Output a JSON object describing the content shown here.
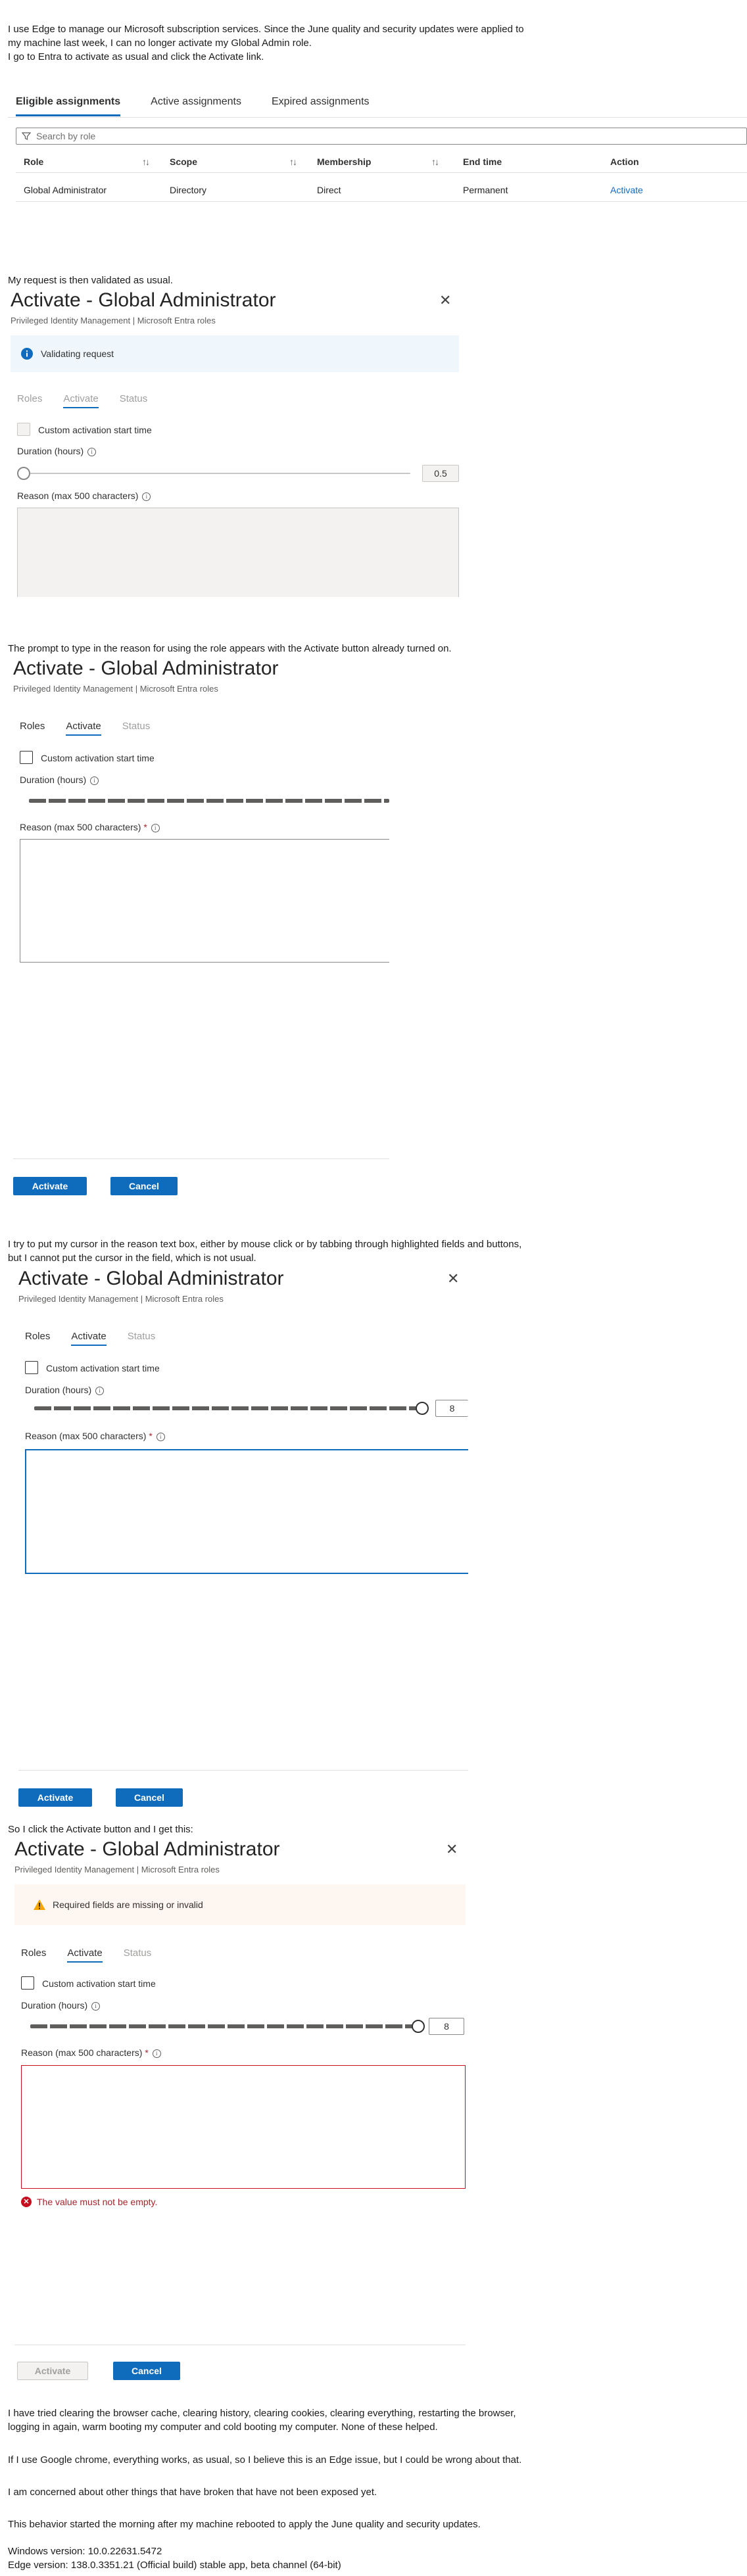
{
  "intro": {
    "text": "I use Edge to manage our Microsoft subscription services.  Since the June quality and security updates were applied to\nmy machine last week, I can no longer activate my Global Admin role.\nI go to Entra to activate as usual and click the Activate link."
  },
  "assignments": {
    "tabs": [
      "Eligible assignments",
      "Active assignments",
      "Expired assignments"
    ],
    "search_placeholder": "Search by role",
    "columns": [
      "Role",
      "Scope",
      "Membership",
      "End time",
      "Action"
    ],
    "row": {
      "role": "Global Administrator",
      "scope": "Directory",
      "membership": "Direct",
      "end_time": "Permanent",
      "action": "Activate"
    }
  },
  "para2": "My request is then validated as usual.",
  "para3": "The prompt to type in the reason for using the role appears with the Activate button already turned on.",
  "para4": "I try to put my cursor in the reason text box, either by mouse click or by tabbing through highlighted fields and buttons,\nbut I cannot put the cursor in the field, which is not usual.",
  "para5": "So I click the Activate button and I get this:",
  "panel": {
    "title": "Activate - Global Administrator",
    "subtitle": "Privileged Identity Management | Microsoft Entra roles",
    "tabs": [
      "Roles",
      "Activate",
      "Status"
    ],
    "custom_start": "Custom activation start time",
    "duration_label": "Duration (hours)",
    "reason_label": "Reason (max 500 characters)",
    "required_mark": "*",
    "activate": "Activate",
    "cancel": "Cancel"
  },
  "panel1": {
    "banner": "Validating request",
    "duration_value": "0.5"
  },
  "panel3": {
    "duration_value": "8"
  },
  "panel4": {
    "banner": "Required fields are missing or invalid",
    "duration_value": "8",
    "error": "The value must not be empty."
  },
  "outro": {
    "p1": "I have tried clearing the browser cache, clearing history, clearing cookies, clearing everything, restarting the browser,\nlogging in again, warm booting my computer and cold booting my computer.  None of these helped.",
    "p2": "If I use Google chrome, everything works, as usual, so I believe this is an Edge issue, but I could be wrong about that.",
    "p3": "I am concerned about other things that have broken that have not been exposed yet.",
    "p4": "This behavior started the morning after my machine rebooted to apply the June quality and security updates.",
    "p5": "Windows version:  10.0.22631.5472\nEdge version: 138.0.3351.21 (Official build) stable app, beta channel (64-bit)"
  },
  "icons": {
    "info": "info-icon",
    "warning": "warning-icon",
    "error": "error-icon",
    "close": "close-icon",
    "filter": "filter-icon",
    "sort": "sort-icon"
  },
  "colors": {
    "accent": "#0f6cbd",
    "error": "#c50f1f",
    "warning": "#f7a600"
  }
}
